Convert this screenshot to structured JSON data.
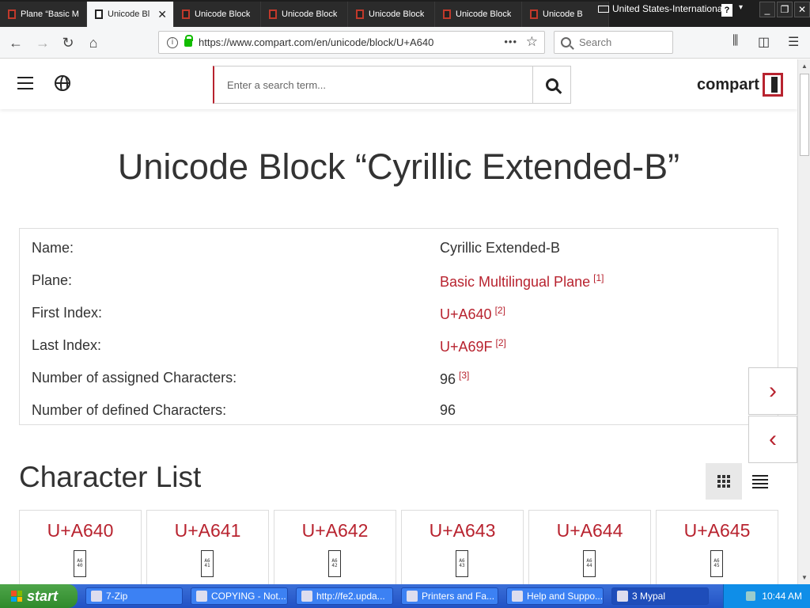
{
  "browser": {
    "tabs": [
      {
        "label": "Plane “Basic M"
      },
      {
        "label": "Unicode Bl",
        "active": true
      },
      {
        "label": "Unicode Block"
      },
      {
        "label": "Unicode Block"
      },
      {
        "label": "Unicode Block"
      },
      {
        "label": "Unicode Block"
      },
      {
        "label": "Unicode B"
      }
    ],
    "close_glyph": "✕",
    "language_indicator": "United States-International",
    "help_label": "?",
    "url": "https://www.compart.com/en/unicode/block/U+A640",
    "search_placeholder": "Search",
    "page_actions_glyph": "•••"
  },
  "site": {
    "search_placeholder": "Enter a search term...",
    "logo_text": "compart",
    "title": "Unicode Block “Cyrillic Extended-B”",
    "info": [
      {
        "key": "Name:",
        "value": "Cyrillic Extended-B",
        "link": false,
        "ref": ""
      },
      {
        "key": "Plane:",
        "value": "Basic Multilingual Plane",
        "link": true,
        "ref": "[1]"
      },
      {
        "key": "First Index:",
        "value": "U+A640",
        "link": true,
        "ref": "[2]"
      },
      {
        "key": "Last Index:",
        "value": "U+A69F",
        "link": true,
        "ref": "[2]"
      },
      {
        "key": "Number of assigned Characters:",
        "value": "96",
        "link": false,
        "ref": "[3]"
      },
      {
        "key": "Number of defined Characters:",
        "value": "96",
        "link": false,
        "ref": ""
      }
    ],
    "character_list_title": "Character List",
    "characters": [
      {
        "code": "U+A640",
        "glyph": "A6\n40"
      },
      {
        "code": "U+A641",
        "glyph": "A6\n41"
      },
      {
        "code": "U+A642",
        "glyph": "A6\n42"
      },
      {
        "code": "U+A643",
        "glyph": "A6\n43"
      },
      {
        "code": "U+A644",
        "glyph": "A6\n44"
      },
      {
        "code": "U+A645",
        "glyph": "A6\n45"
      }
    ],
    "next_arrow": "›",
    "prev_arrow": "‹"
  },
  "taskbar": {
    "start_label": "start",
    "tasks": [
      {
        "label": "7-Zip"
      },
      {
        "label": "COPYING - Not..."
      },
      {
        "label": "http://fe2.upda..."
      },
      {
        "label": "Printers and Fa..."
      },
      {
        "label": "Help and Suppo..."
      },
      {
        "label": "3 Mypal",
        "active": true
      }
    ],
    "clock": "10:44 AM"
  },
  "colors": {
    "accent": "#b8232f",
    "link": "#b8232f",
    "taskbar": "#2252c4",
    "start": "#3a9a36"
  }
}
